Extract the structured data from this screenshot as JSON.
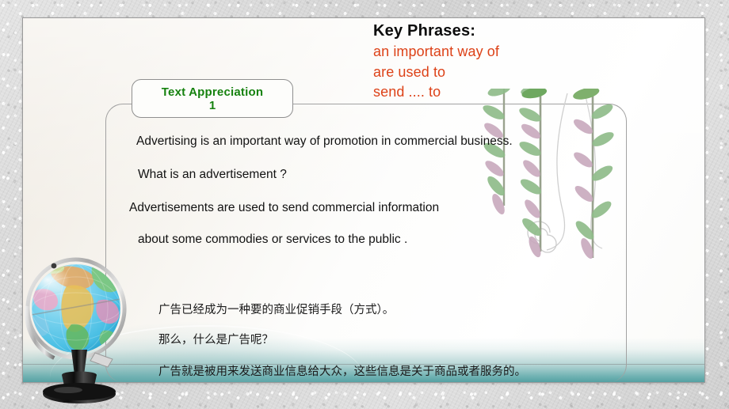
{
  "slide": {
    "key_phrases": {
      "title": "Key Phrases:",
      "lines": [
        "an important way of",
        "are used to",
        "send .... to"
      ],
      "color": "#dd4218"
    },
    "label_pill": {
      "line1": "Text Appreciation",
      "line2": "1",
      "color": "#16820f"
    },
    "english_lines": [
      "Advertising is an important way of promotion in commercial business.",
      "What is an advertisement ?",
      "Advertisements are used to send commercial information",
      "about some commodies or services to the public ."
    ],
    "chinese_lines": [
      "广告已经成为一种要的商业促销手段（方式）。",
      "那么，什么是广告呢？",
      "广告就是被用来发送商业信息给大众，这些信息是关于商品或者服务的。"
    ],
    "decorations": {
      "globe": "globe-icon",
      "vines": "hanging-vine-icon",
      "spiral": "spiral-tendril-icon"
    },
    "colors": {
      "board": "#fdfcfa",
      "wall": "#dcdcdc",
      "teal_band": "#4c9c9e",
      "frame_border": "#a2a2a2"
    }
  }
}
